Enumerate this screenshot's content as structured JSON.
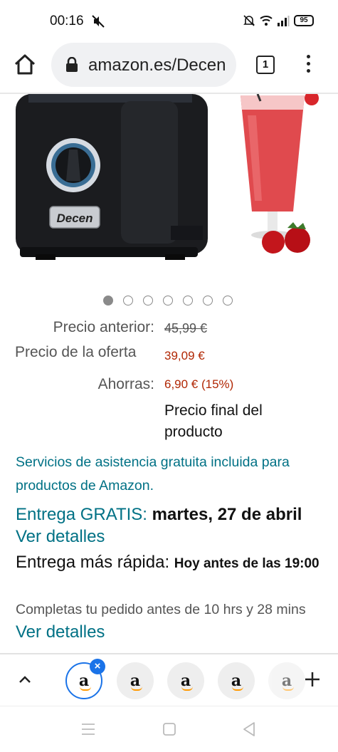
{
  "status_bar": {
    "time": "00:16",
    "battery": "95"
  },
  "browser": {
    "url_text": "amazon.es/Decen",
    "tab_count": "1"
  },
  "product": {
    "brand_logo": "Decen",
    "carousel": {
      "count": 7,
      "active_index": 0
    }
  },
  "price": {
    "previous_label": "Precio anterior:",
    "previous_value": "45,99 €",
    "offer_label": "Precio de la oferta",
    "offer_value": "39,09 €",
    "savings_label": "Ahorras:",
    "savings_value": "6,90 € (15%)",
    "final_note": "Precio final del producto"
  },
  "services_text": "Servicios de asistencia gratuita incluida para productos de Amazon.",
  "delivery": {
    "free_label": "Entrega GRATIS:",
    "free_date": "martes, 27 de abril",
    "details_link": "Ver detalles"
  },
  "faster_delivery": {
    "label": "Entrega más rápida:",
    "time": "Hoy antes de las 19:00"
  },
  "cutoff": {
    "text": "Completas tu pedido antes de 10 hrs y 28 mins",
    "details_link": "Ver detalles"
  },
  "tab_strip": {
    "favicon_letter": "a",
    "close_badge": "×"
  },
  "colors": {
    "link_teal": "#007185",
    "price_red": "#b12704",
    "accent_blue": "#1a73e8",
    "amazon_orange": "#ff9900"
  }
}
